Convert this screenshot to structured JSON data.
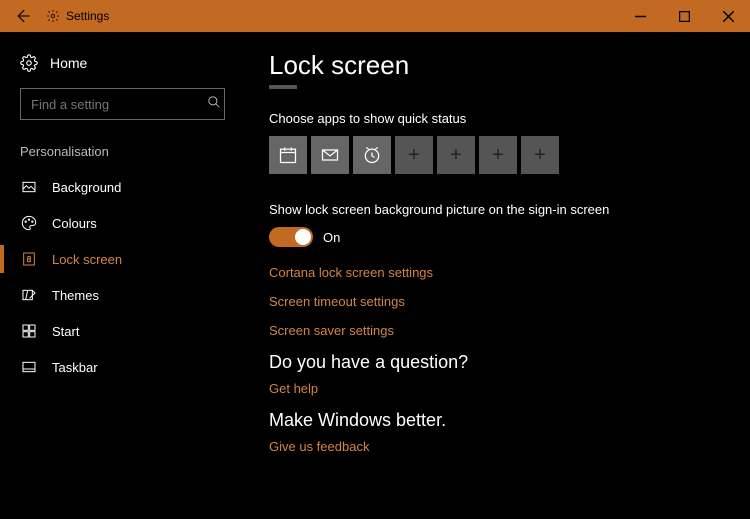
{
  "titlebar": {
    "title": "Settings"
  },
  "sidebar": {
    "home": "Home",
    "search_placeholder": "Find a setting",
    "section": "Personalisation",
    "items": [
      {
        "label": "Background"
      },
      {
        "label": "Colours"
      },
      {
        "label": "Lock screen"
      },
      {
        "label": "Themes"
      },
      {
        "label": "Start"
      },
      {
        "label": "Taskbar"
      }
    ]
  },
  "main": {
    "title": "Lock screen",
    "quick_status_label": "Choose apps to show quick status",
    "signin_bg_label": "Show lock screen background picture on the sign-in screen",
    "toggle_state": "On",
    "links": {
      "cortana": "Cortana lock screen settings",
      "timeout": "Screen timeout settings",
      "saver": "Screen saver settings"
    },
    "question_heading": "Do you have a question?",
    "get_help": "Get help",
    "better_heading": "Make Windows better.",
    "feedback": "Give us feedback"
  }
}
